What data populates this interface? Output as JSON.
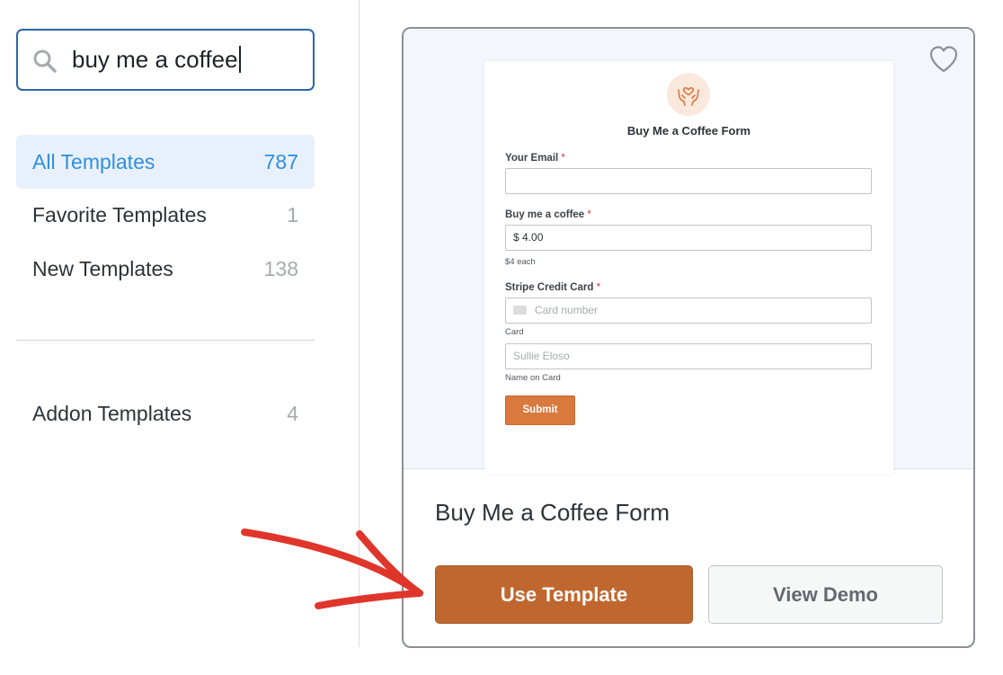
{
  "search": {
    "value": "buy me a coffee"
  },
  "categories": [
    {
      "label": "All Templates",
      "count": "787",
      "active": true
    },
    {
      "label": "Favorite Templates",
      "count": "1"
    },
    {
      "label": "New Templates",
      "count": "138"
    }
  ],
  "addon_categories": [
    {
      "label": "Addon Templates",
      "count": "4"
    }
  ],
  "template_card": {
    "name": "Buy Me a Coffee Form",
    "use_label": "Use Template",
    "demo_label": "View Demo",
    "preview": {
      "title": "Buy Me a Coffee Form",
      "email_label": "Your Email",
      "required_mark": "*",
      "coffee_label": "Buy me a coffee",
      "coffee_value": "$ 4.00",
      "coffee_hint": "$4 each",
      "card_label": "Stripe Credit Card",
      "card_placeholder": "Card number",
      "card_sublabel": "Card",
      "name_placeholder": "Sullie Eloso",
      "name_sublabel": "Name on Card",
      "submit_label": "Submit"
    }
  },
  "colors": {
    "accent_blue": "#2f8fdf",
    "use_button": "#c0672f",
    "submit_button": "#d9793d",
    "annotation_arrow": "#e0352b"
  },
  "icons": [
    "search-icon",
    "heart-icon",
    "coffee-hands-icon",
    "credit-card-icon",
    "red-arrow-annotation"
  ]
}
